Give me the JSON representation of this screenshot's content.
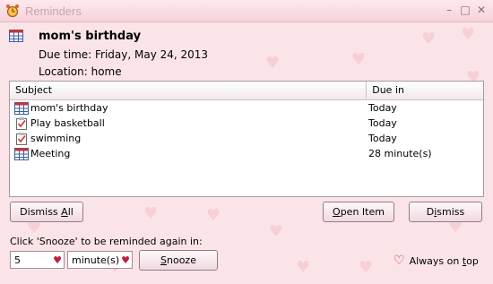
{
  "window": {
    "title": "Reminders"
  },
  "reminder": {
    "subject": "mom's birthday",
    "due_time": "Due time: Friday, May 24, 2013",
    "location": "Location: home"
  },
  "list": {
    "headers": {
      "subject": "Subject",
      "due": "Due in"
    },
    "rows": [
      {
        "subject": "mom's birthday",
        "due": "Today",
        "icon": "calendar-icon"
      },
      {
        "subject": "Play basketball",
        "due": "Today",
        "icon": "task-icon"
      },
      {
        "subject": "swimming",
        "due": "Today",
        "icon": "task-icon"
      },
      {
        "subject": "Meeting",
        "due": "28 minute(s)",
        "icon": "calendar-icon"
      }
    ]
  },
  "buttons": {
    "dismiss_all_prefix": "Dismiss ",
    "dismiss_all_ul": "A",
    "dismiss_all_suffix": "ll",
    "open_item_ul": "O",
    "open_item_suffix": "pen Item",
    "dismiss_prefix": "D",
    "dismiss_ul": "i",
    "dismiss_suffix": "smiss",
    "snooze_ul": "S",
    "snooze_suffix": "nooze"
  },
  "snooze": {
    "label": "Click 'Snooze' to be reminded again in:",
    "amount": "5",
    "unit": "minute(s)"
  },
  "always_on_top": {
    "prefix": "Always on ",
    "ul": "t",
    "suffix": "op"
  },
  "colors": {
    "accent": "#c0203b",
    "background": "#fbe4e8"
  }
}
